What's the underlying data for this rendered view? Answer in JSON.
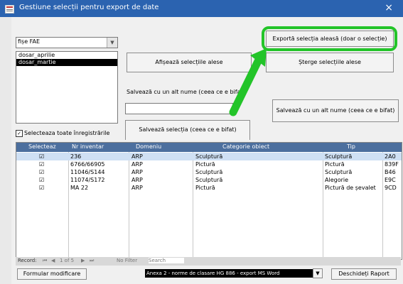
{
  "window": {
    "title": "Gestiune selecții pentru export de date",
    "close": "×"
  },
  "filter_combo": {
    "value": "fișe FAE"
  },
  "selections_list": [
    "dosar_aprilie",
    "dosar_martie"
  ],
  "buttons": {
    "export": "Exportă selecția aleasă (doar o selecție)",
    "show": "Afișează selecțiile alese",
    "delete": "Șterge selecțiile alese",
    "save_as": "Salvează cu un alt nume (ceea ce e bifat)",
    "save": "Salvează selecția (ceea ce e bifat)",
    "formular": "Formular modificare",
    "open_report": "Deschideți Raport"
  },
  "save_as_label": "Salvează cu un alt nume (ceea ce e bifat)",
  "select_all_label": "Selecteaza toate înregistrările",
  "table": {
    "headers": [
      "Selecteaz",
      "Nr inventar",
      "Domeniu",
      "Categorie obiect",
      "Tip"
    ],
    "rows": [
      {
        "check": "☑",
        "nr": "236",
        "domeniu": "ARP",
        "categorie": "Sculptură",
        "tip": "Sculptură",
        "code": "2A0"
      },
      {
        "check": "☑",
        "nr": "6766/66905",
        "domeniu": "ARP",
        "categorie": "Pictură",
        "tip": "Pictură",
        "code": "839F"
      },
      {
        "check": "☑",
        "nr": "11046/S144",
        "domeniu": "ARP",
        "categorie": "Sculptură",
        "tip": "Sculptură",
        "code": "B46"
      },
      {
        "check": "☑",
        "nr": "11074/S172",
        "domeniu": "ARP",
        "categorie": "Sculptură",
        "tip": "Alegorie",
        "code": "E9C"
      },
      {
        "check": "☑",
        "nr": "MA 22",
        "domeniu": "ARP",
        "categorie": "Pictură",
        "tip": "Pictură de șevalet",
        "code": "9CD"
      }
    ]
  },
  "record_nav": {
    "label": "Record:",
    "position": "1 of 5",
    "filter": "No Filter",
    "search": "Search"
  },
  "report_select": {
    "value": "Anexa 2 - norme de clasare HG 886 - export MS Word"
  },
  "colors": {
    "titlebar": "#2b63b0",
    "header": "#4c6f9e",
    "highlight": "#23c429"
  }
}
